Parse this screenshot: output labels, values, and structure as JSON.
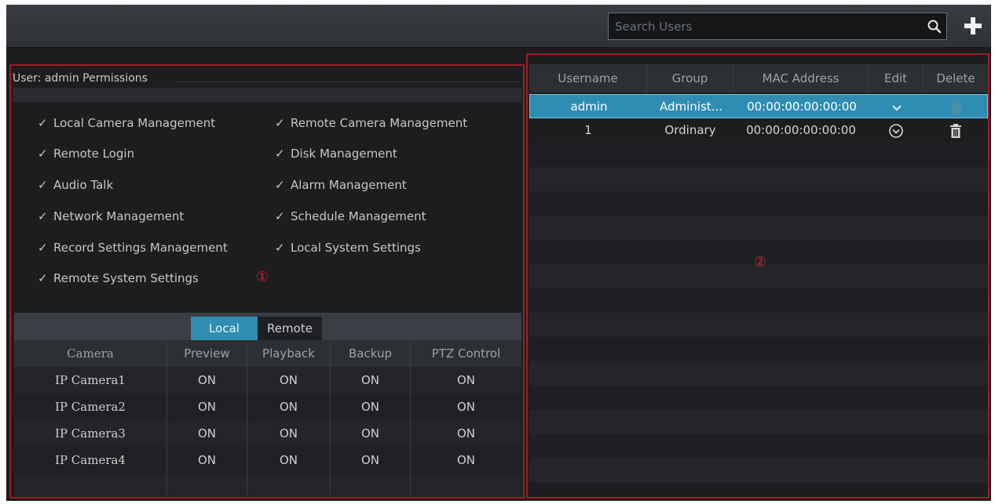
{
  "search": {
    "placeholder": "Search Users"
  },
  "icons": {
    "search": "search-icon",
    "add": "plus-icon",
    "check": "check-icon",
    "edit": "chevron-down-circle-icon",
    "delete": "trash-icon"
  },
  "colors": {
    "accent": "#2f8db3",
    "highlight_border": "#9a1f24",
    "marker": "#c0262c"
  },
  "permissions": {
    "header": "User: admin Permissions",
    "items": [
      "Local Camera Management",
      "Remote Camera Management",
      "Remote Login",
      "Disk Management",
      "Audio Talk",
      "Alarm Management",
      "Network Management",
      "Schedule Management",
      "Record Settings Management",
      "Local System Settings",
      "Remote System Settings"
    ],
    "marker": "①"
  },
  "camera_tabs": {
    "local": "Local",
    "remote": "Remote",
    "active": "Local"
  },
  "camera_table": {
    "columns": [
      "Camera",
      "Preview",
      "Playback",
      "Backup",
      "PTZ Control"
    ],
    "rows": [
      [
        "IP Camera1",
        "ON",
        "ON",
        "ON",
        "ON"
      ],
      [
        "IP Camera2",
        "ON",
        "ON",
        "ON",
        "ON"
      ],
      [
        "IP Camera3",
        "ON",
        "ON",
        "ON",
        "ON"
      ],
      [
        "IP Camera4",
        "ON",
        "ON",
        "ON",
        "ON"
      ]
    ]
  },
  "user_table": {
    "columns": [
      "Username",
      "Group",
      "MAC Address",
      "Edit",
      "Delete"
    ],
    "rows": [
      {
        "username": "admin",
        "group": "Administ...",
        "mac": "00:00:00:00:00:00",
        "selected": true
      },
      {
        "username": "1",
        "group": "Ordinary",
        "mac": "00:00:00:00:00:00",
        "selected": false
      }
    ],
    "marker": "②"
  }
}
